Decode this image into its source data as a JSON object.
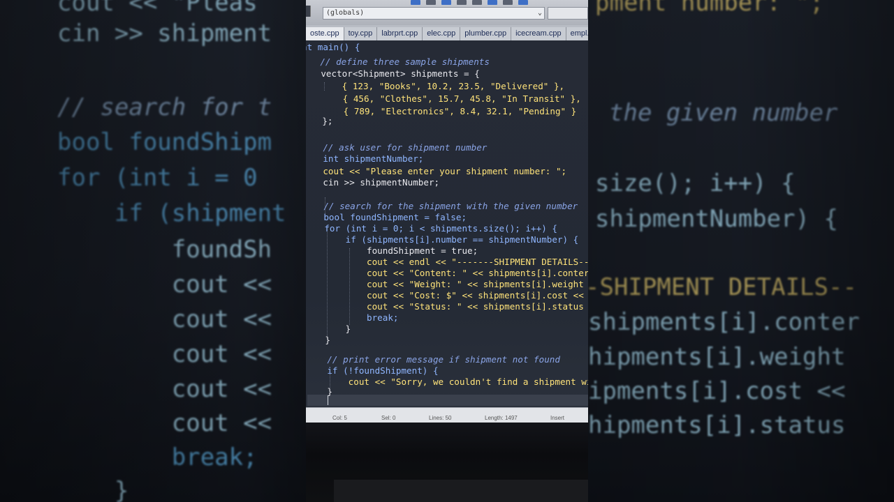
{
  "toolbar": {
    "scope_value": "(globals)"
  },
  "tabs": [
    {
      "label": "oste.cpp"
    },
    {
      "label": "toy.cpp"
    },
    {
      "label": "labrprt.cpp"
    },
    {
      "label": "elec.cpp"
    },
    {
      "label": "plumber.cpp"
    },
    {
      "label": "icecream.cpp"
    },
    {
      "label": "empl.cpp"
    }
  ],
  "editor": {
    "lines": [
      "nt main() {",
      "    // define three sample shipments",
      "    vector<Shipment> shipments = {",
      "        { 123, \"Books\", 10.2, 23.5, \"Delivered\" },",
      "        { 456, \"Clothes\", 15.7, 45.8, \"In Transit\" },",
      "        { 789, \"Electronics\", 8.4, 32.1, \"Pending\" }",
      "    };",
      "    // ask user for shipment number",
      "    int shipmentNumber;",
      "    cout << \"Please enter your shipment number: \";",
      "    cin >> shipmentNumber;",
      "    // search for the shipment with the given number",
      "    bool foundShipment = false;",
      "    for (int i = 0; i < shipments.size(); i++) {",
      "        if (shipments[i].number == shipmentNumber) {",
      "            foundShipment = true;",
      "            cout << endl << \"-------SHIPMENT DETAILS--",
      "            cout << \"Content: \" << shipments[i].conter",
      "            cout << \"Weight: \" << shipments[i].weight",
      "            cout << \"Cost: $\" << shipments[i].cost <<",
      "            cout << \"Status: \" << shipments[i].status",
      "            break;",
      "        }",
      "    }",
      "    // print error message if shipment not found",
      "    if (!foundShipment) {",
      "        cout << \"Sorry, we couldn't find a shipment wit",
      "    }"
    ]
  },
  "statusbar": {
    "col_label": "Col:",
    "col_value": "5",
    "sel_label": "Sel:",
    "sel_value": "0",
    "lines_label": "Lines:",
    "lines_value": "50",
    "length_label": "Length:",
    "length_value": "1497",
    "mode": "Insert"
  },
  "background_left": {
    "lines": [
      "cout << \"Pleas",
      "cin >> shipment",
      "// search for t",
      "bool foundShipm",
      "for (int i = 0",
      "    if (shipment",
      "        foundSh",
      "        cout <<",
      "        cout <<",
      "        cout <<",
      "        cout <<",
      "        cout <<",
      "        break;",
      "    }"
    ]
  },
  "background_right": {
    "lines": [
      "pment number: \";",
      "the given number",
      "size(); i++) {",
      "shipmentNumber) {",
      "-SHIPMENT DETAILS--",
      "shipments[i].conter",
      "hipments[i].weight",
      "ipments[i].cost <<",
      "hipments[i].status"
    ]
  },
  "colors": {
    "keyword": "#8fb6ff",
    "string": "#ffe37a",
    "number": "#d28cff",
    "comment": "#8aa4e6",
    "editor_bg": "#262b36"
  }
}
